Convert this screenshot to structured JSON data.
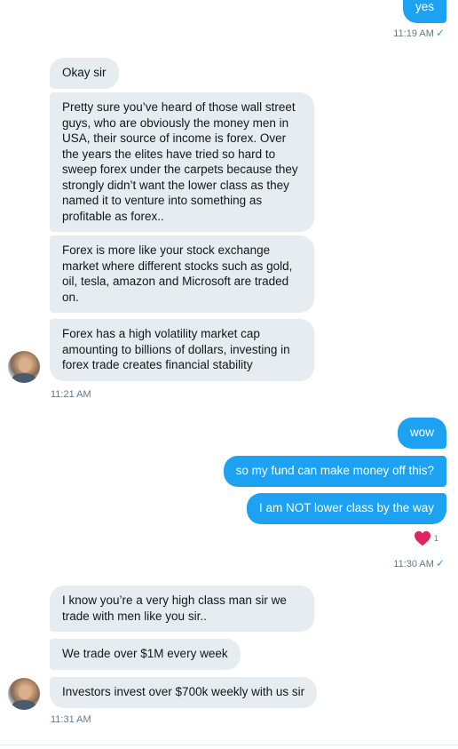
{
  "conversation": {
    "messages": [
      {
        "id": "m1",
        "sender": "me",
        "text": "yes"
      },
      {
        "id": "m2",
        "sender": "them",
        "text": "Okay sir"
      },
      {
        "id": "m3",
        "sender": "them",
        "text": "Pretty sure you’ve heard of those wall street guys, who are obviously the money men in USA, their source of income is forex. Over the years the elites have tried so hard to sweep forex under the carpets because they strongly didn’t want the lower class as they named it to venture into something as profitable as forex.."
      },
      {
        "id": "m4",
        "sender": "them",
        "text": "Forex is more like your stock exchange market where different stocks such as gold, oil, tesla, amazon and Microsoft are traded on."
      },
      {
        "id": "m5",
        "sender": "them",
        "text": "Forex has a high volatility market cap amounting to billions of dollars, investing in forex trade creates financial stability"
      },
      {
        "id": "m6",
        "sender": "me",
        "text": "wow"
      },
      {
        "id": "m7",
        "sender": "me",
        "text": "so my fund can make money off this?"
      },
      {
        "id": "m8",
        "sender": "me",
        "text": "I am NOT lower class by the way"
      },
      {
        "id": "m9",
        "sender": "them",
        "text": "I know you’re a very high class man sir we trade with men like you sir.."
      },
      {
        "id": "m10",
        "sender": "them",
        "text": "We trade over $1M every week"
      },
      {
        "id": "m11",
        "sender": "them",
        "text": "Investors invest over $700k weekly with us sir"
      }
    ],
    "timestamps": {
      "t1": "11:19 AM",
      "t2": "11:21 AM",
      "t3": "11:30 AM",
      "t4": "11:31 AM"
    },
    "read_check": "✓",
    "reaction": {
      "icon": "heart-icon",
      "count": "1",
      "color": "#e0245e"
    }
  },
  "colors": {
    "outgoing_bubble": "#1da1f2",
    "incoming_bubble": "#e6ecf0",
    "meta_text": "#657786"
  }
}
